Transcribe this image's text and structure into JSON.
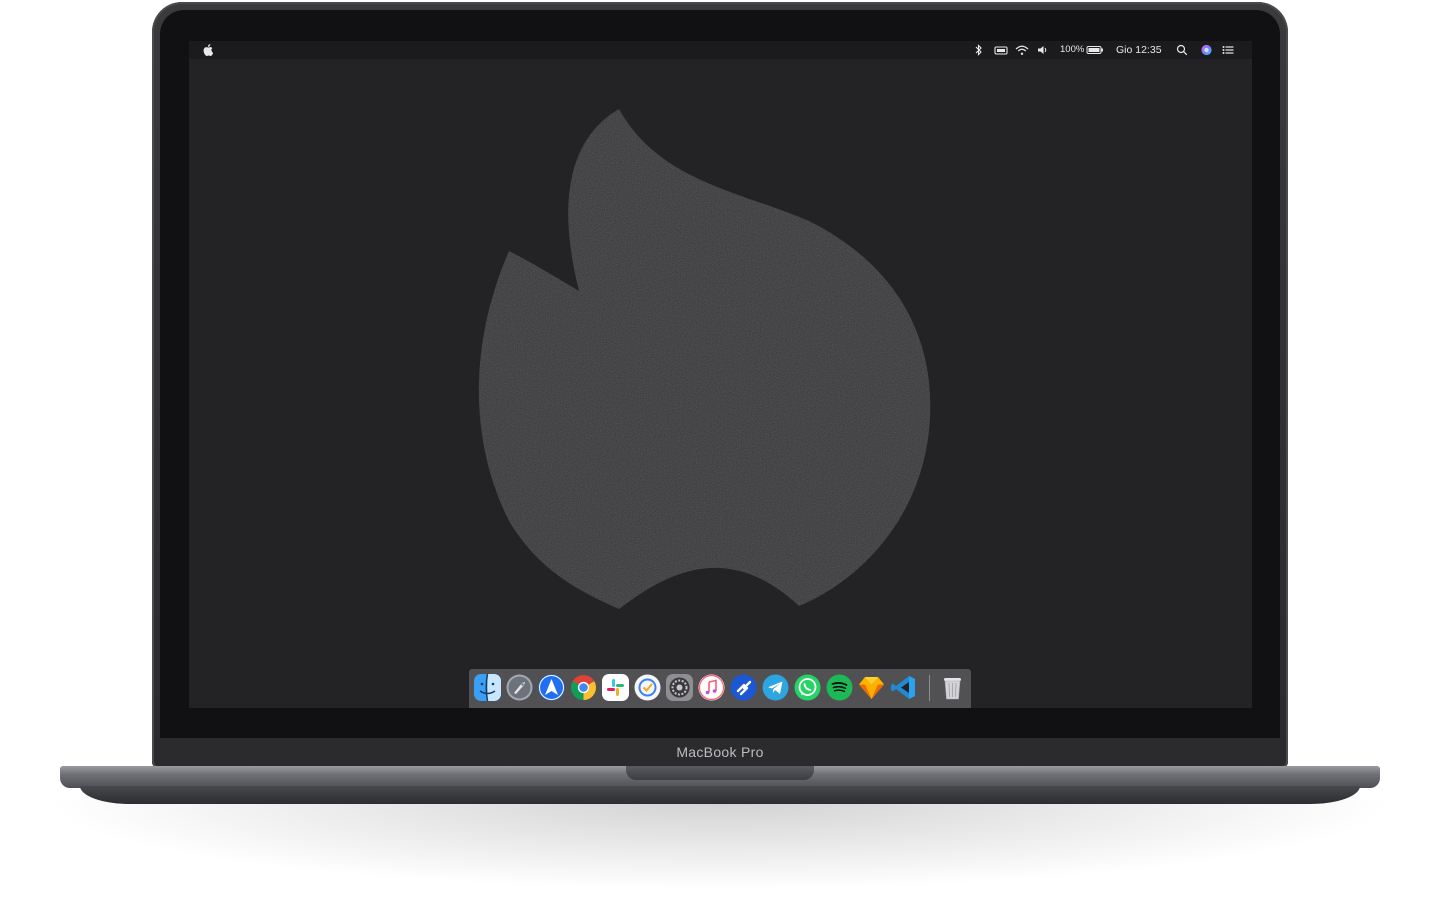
{
  "device": {
    "brand_label": "MacBook Pro"
  },
  "menubar": {
    "clock": "Gio 12:35",
    "battery_percent": "100%",
    "status_icons": [
      "bluetooth-icon",
      "keyboard-icon",
      "wifi-icon",
      "volume-icon",
      "battery-icon",
      "search-icon",
      "siri-icon",
      "notification-center-icon"
    ]
  },
  "dock": {
    "apps": [
      {
        "name": "Finder",
        "icon": "finder-icon",
        "color": "#2d8cf0"
      },
      {
        "name": "Launchpad",
        "icon": "launchpad-icon",
        "color": "#8a8f98"
      },
      {
        "name": "Spark",
        "icon": "spark-icon",
        "color": "#1e6fe8"
      },
      {
        "name": "Chrome",
        "icon": "chrome-icon",
        "color": "#f2f2f2"
      },
      {
        "name": "Slack",
        "icon": "slack-icon",
        "color": "#ffffff"
      },
      {
        "name": "Things",
        "icon": "things-icon",
        "color": "#ffffff"
      },
      {
        "name": "System Preferences",
        "icon": "system-preferences-icon",
        "color": "#6e6e73"
      },
      {
        "name": "iTunes",
        "icon": "itunes-icon",
        "color": "#ffffff"
      },
      {
        "name": "Jira",
        "icon": "jira-icon",
        "color": "#1a5fd6"
      },
      {
        "name": "Telegram",
        "icon": "telegram-icon",
        "color": "#2ca5e0"
      },
      {
        "name": "WhatsApp",
        "icon": "whatsapp-icon",
        "color": "#25d366"
      },
      {
        "name": "Spotify",
        "icon": "spotify-icon",
        "color": "#1db954"
      },
      {
        "name": "Sketch",
        "icon": "sketch-icon",
        "color": "#f7b500"
      },
      {
        "name": "Visual Studio Code",
        "icon": "vscode-icon",
        "color": "#1f8ad2"
      },
      {
        "name": "Trash",
        "icon": "trash-icon",
        "color": "#d9d9dc"
      }
    ]
  }
}
